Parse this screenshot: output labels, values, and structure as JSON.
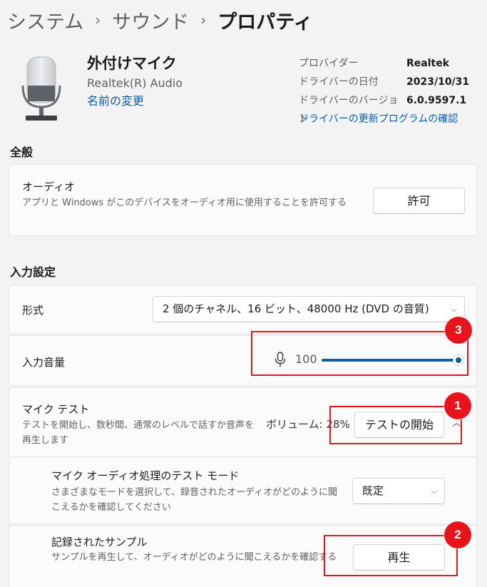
{
  "breadcrumb": {
    "items": [
      "システム",
      "サウンド",
      "プロパティ"
    ],
    "separator": "›"
  },
  "device": {
    "name": "外付けマイク",
    "driver": "Realtek(R) Audio",
    "rename_link": "名前の変更",
    "icon": "microphone-icon"
  },
  "properties": {
    "rows": [
      {
        "label": "プロバイダー",
        "value": "Realtek"
      },
      {
        "label": "ドライバーの日付",
        "value": "2023/10/31"
      },
      {
        "label": "ドライバーのバージョン",
        "value": "6.0.9597.1"
      }
    ],
    "update_link": "ドライバーの更新プログラムの確認"
  },
  "general": {
    "title": "全般",
    "audio": {
      "title": "オーディオ",
      "description": "アプリと Windows がこのデバイスをオーディオ用に使用することを許可する",
      "button": "許可"
    }
  },
  "input": {
    "title": "入力設定",
    "format": {
      "label": "形式",
      "selected": "2 個のチャネル、16 ビット、48000 Hz (DVD の音質)"
    },
    "volume": {
      "label": "入力音量",
      "value": "100",
      "level": 100
    },
    "mic_test": {
      "title": "マイク テスト",
      "description": "テストを開始し、数秒間、通常のレベルで話すか音声を再生します",
      "volume_label": "ボリューム: 28%",
      "button": "テストの開始"
    },
    "test_mode": {
      "title": "マイク オーディオ処理のテスト モード",
      "description": "さまざまなモードを選択して、録音されたオーディオがどのように聞こえるかを確認してください",
      "selected": "既定"
    },
    "sample": {
      "title": "記録されたサンプル",
      "description": "サンプルを再生して、オーディオがどのように聞こえるかを確認する",
      "button": "再生"
    }
  },
  "annotations": [
    "1",
    "2",
    "3"
  ],
  "colors": {
    "accent": "#0f5c9e",
    "link": "#0b5cab",
    "annotation": "#e8141c"
  }
}
